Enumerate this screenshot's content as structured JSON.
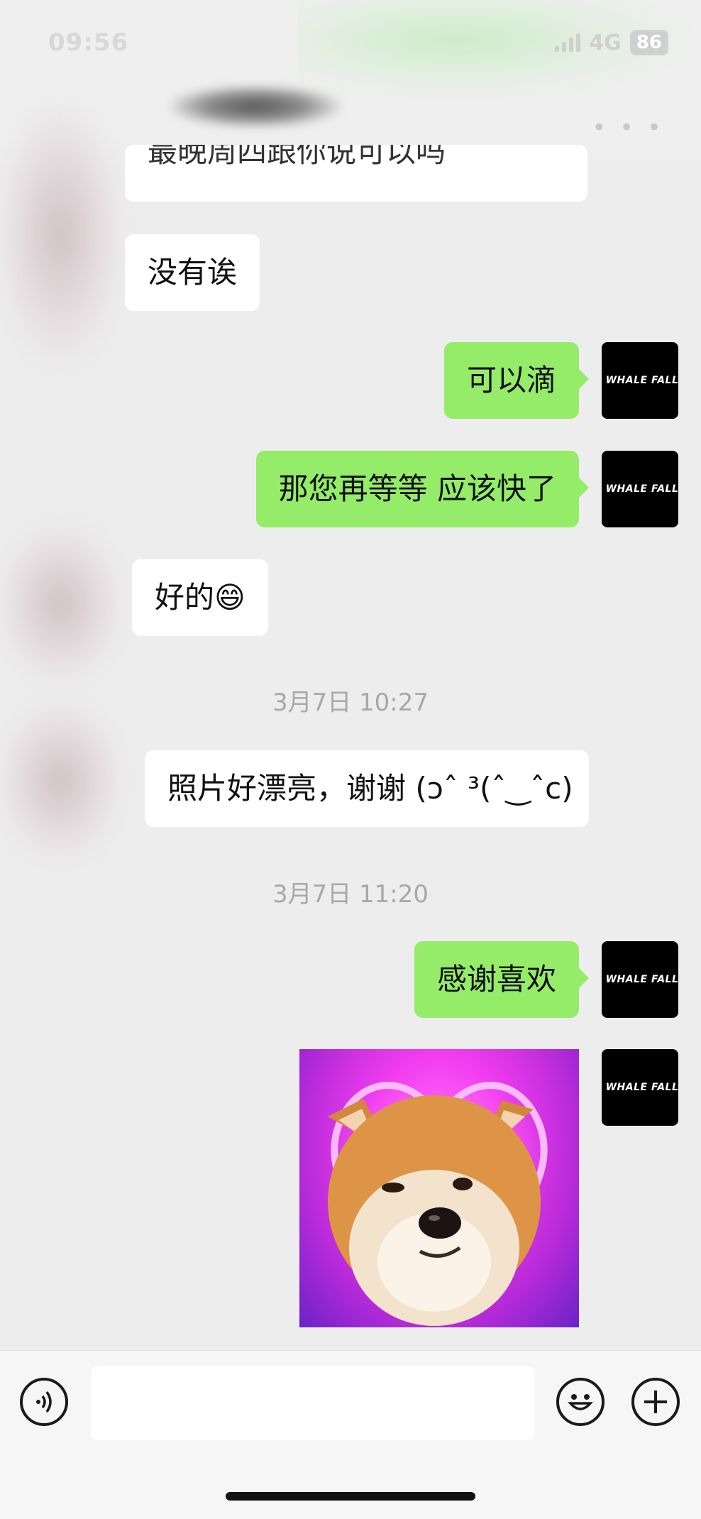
{
  "status": {
    "time": "09:56",
    "network": "4G",
    "battery": "86"
  },
  "messages": [
    {
      "side": "incoming",
      "text": "最晚周四跟你说可以吗"
    },
    {
      "side": "incoming",
      "text": "没有诶"
    },
    {
      "side": "outgoing",
      "text": "可以滴"
    },
    {
      "side": "outgoing",
      "text": "那您再等等 应该快了"
    },
    {
      "side": "incoming",
      "text": "好的😄"
    },
    {
      "side": "incoming",
      "text": "照片好漂亮，谢谢 (ɔˆ ³(ˆ‿ˆc)"
    },
    {
      "side": "outgoing",
      "text": "感谢喜欢"
    }
  ],
  "timestamps": [
    "3月7日 10:27",
    "3月7日 11:20"
  ],
  "avatar": {
    "label": "WHALE FALL"
  },
  "sticker": {
    "icon": "shiba-heart-sticker"
  },
  "colors": {
    "background": "#ededed",
    "outgoing_bubble": "#95ec69",
    "incoming_bubble": "#ffffff",
    "sticker_pink": "#f23df0"
  },
  "input": {
    "placeholder": "",
    "value": ""
  },
  "icons": {
    "voice": "voice-icon",
    "emoji": "emoji-icon",
    "more": "plus-icon"
  }
}
